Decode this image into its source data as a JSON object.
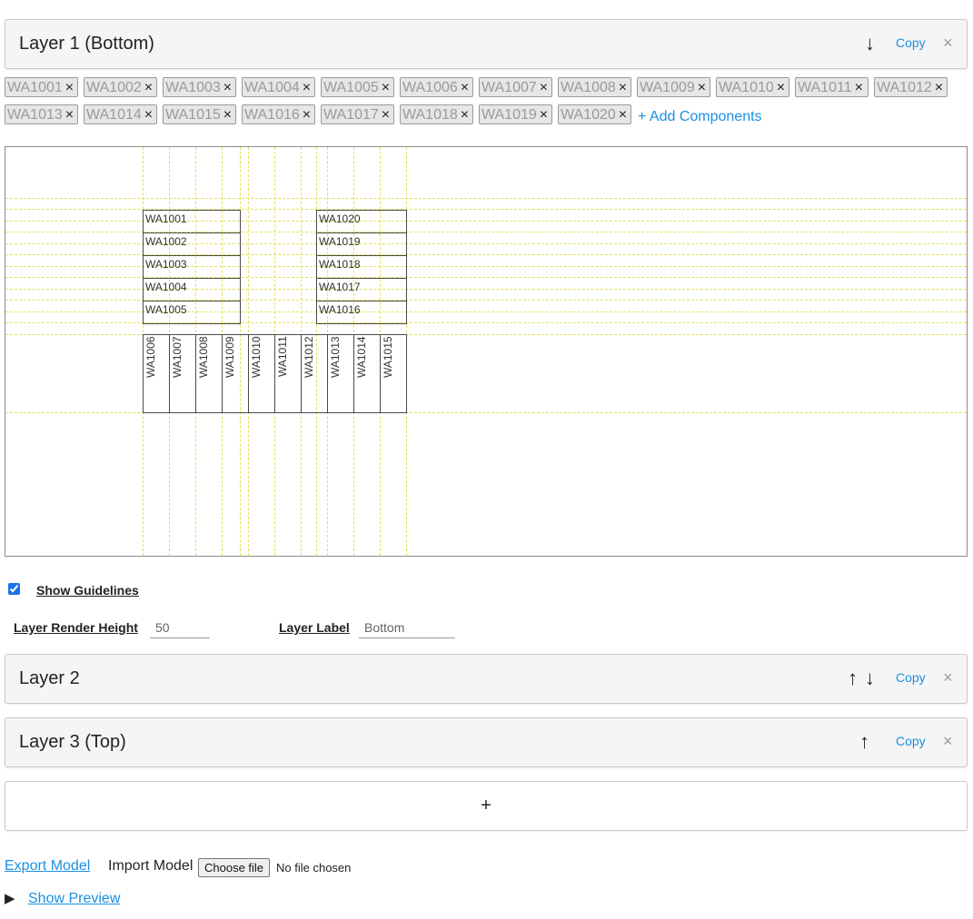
{
  "layers": [
    {
      "title": "Layer 1 (Bottom)",
      "arrows": [
        "↓"
      ],
      "copy": "Copy",
      "close": "×"
    },
    {
      "title": "Layer 2",
      "arrows": [
        "↑",
        "↓"
      ],
      "copy": "Copy",
      "close": "×"
    },
    {
      "title": "Layer 3 (Top)",
      "arrows": [
        "↑"
      ],
      "copy": "Copy",
      "close": "×"
    }
  ],
  "components": [
    "WA1001",
    "WA1002",
    "WA1003",
    "WA1004",
    "WA1005",
    "WA1006",
    "WA1007",
    "WA1008",
    "WA1009",
    "WA1010",
    "WA1011",
    "WA1012",
    "WA1013",
    "WA1014",
    "WA1015",
    "WA1016",
    "WA1017",
    "WA1018",
    "WA1019",
    "WA1020"
  ],
  "chip_remove": "×",
  "add_components": "+ Add Components",
  "canvas": {
    "left_block": [
      "WA1001",
      "WA1002",
      "WA1003",
      "WA1004",
      "WA1005"
    ],
    "right_block": [
      "WA1020",
      "WA1019",
      "WA1018",
      "WA1017",
      "WA1016"
    ],
    "bottom_row": [
      "WA1006",
      "WA1007",
      "WA1008",
      "WA1009",
      "WA1010",
      "WA1011",
      "WA1012",
      "WA1013",
      "WA1014",
      "WA1015"
    ]
  },
  "show_guidelines": {
    "label": "Show Guidelines",
    "checked": true
  },
  "render_height": {
    "label": "Layer Render Height",
    "value": "50"
  },
  "layer_label": {
    "label": "Layer Label",
    "value": "Bottom"
  },
  "add_layer": "+",
  "export_model": "Export Model",
  "import_model": "Import Model",
  "file_button": "Choose file",
  "file_status": "No file chosen",
  "preview_toggle": "▶",
  "show_preview": "Show Preview",
  "colors": {
    "link": "#1a8fe3",
    "guideline": "#e4e05a",
    "chip_bg": "#e6e6e6",
    "panel_bg": "#f5f5f5"
  }
}
